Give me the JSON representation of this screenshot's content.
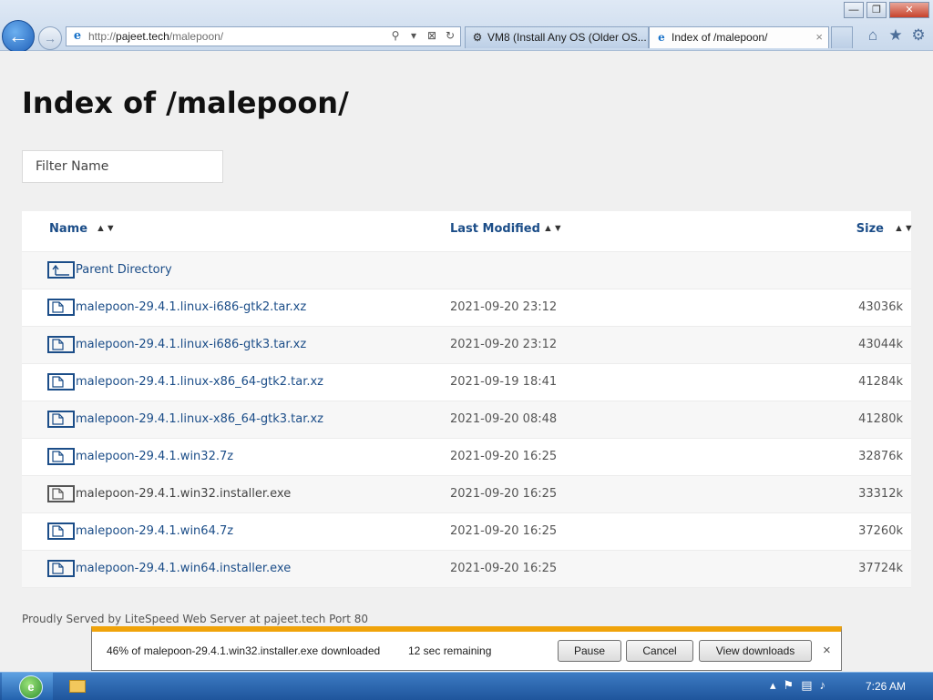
{
  "window": {
    "minimize": "—",
    "maximize": "❐",
    "close": "✕"
  },
  "address_bar": {
    "url_scheme": "http://",
    "url_host": "pajeet.tech",
    "url_path": "/malepoon/",
    "tools": [
      "⚲",
      "▾",
      "⊠",
      "↻"
    ]
  },
  "tabs": [
    {
      "label": "VM8 (Install Any OS (Older OS...",
      "active": false
    },
    {
      "label": "Index of /malepoon/",
      "active": true,
      "close": "×"
    }
  ],
  "toolbar_icons": [
    "home-icon",
    "star-icon",
    "gear-icon"
  ],
  "page": {
    "title": "Index of /malepoon/",
    "filter_placeholder": "Filter Name",
    "headers": {
      "name": "Name",
      "modified": "Last Modified",
      "size": "Size",
      "sort_glyph": "▲▼"
    },
    "parent": "Parent Directory",
    "files": [
      {
        "name": "malepoon-29.4.1.linux-i686-gtk2.tar.xz",
        "modified": "2021-09-20 23:12",
        "size": "43036k"
      },
      {
        "name": "malepoon-29.4.1.linux-i686-gtk3.tar.xz",
        "modified": "2021-09-20 23:12",
        "size": "43044k"
      },
      {
        "name": "malepoon-29.4.1.linux-x86_64-gtk2.tar.xz",
        "modified": "2021-09-19 18:41",
        "size": "41284k"
      },
      {
        "name": "malepoon-29.4.1.linux-x86_64-gtk3.tar.xz",
        "modified": "2021-09-20 08:48",
        "size": "41280k"
      },
      {
        "name": "malepoon-29.4.1.win32.7z",
        "modified": "2021-09-20 16:25",
        "size": "32876k"
      },
      {
        "name": "malepoon-29.4.1.win32.installer.exe",
        "modified": "2021-09-20 16:25",
        "size": "33312k"
      },
      {
        "name": "malepoon-29.4.1.win64.7z",
        "modified": "2021-09-20 16:25",
        "size": "37260k"
      },
      {
        "name": "malepoon-29.4.1.win64.installer.exe",
        "modified": "2021-09-20 16:25",
        "size": "37724k"
      }
    ],
    "footer": "Proudly Served by LiteSpeed Web Server at pajeet.tech Port 80"
  },
  "download_bar": {
    "status": "46% of malepoon-29.4.1.win32.installer.exe downloaded",
    "progress": 0.46,
    "remaining": "12 sec remaining",
    "pause": "Pause",
    "cancel": "Cancel",
    "view": "View downloads",
    "close": "×",
    "accent": "#f0a30a"
  },
  "taskbar": {
    "clock": "7:26 AM",
    "tray_up": "▴"
  },
  "colors": {
    "link": "#1b4d88",
    "background": "#f0f0f0"
  }
}
